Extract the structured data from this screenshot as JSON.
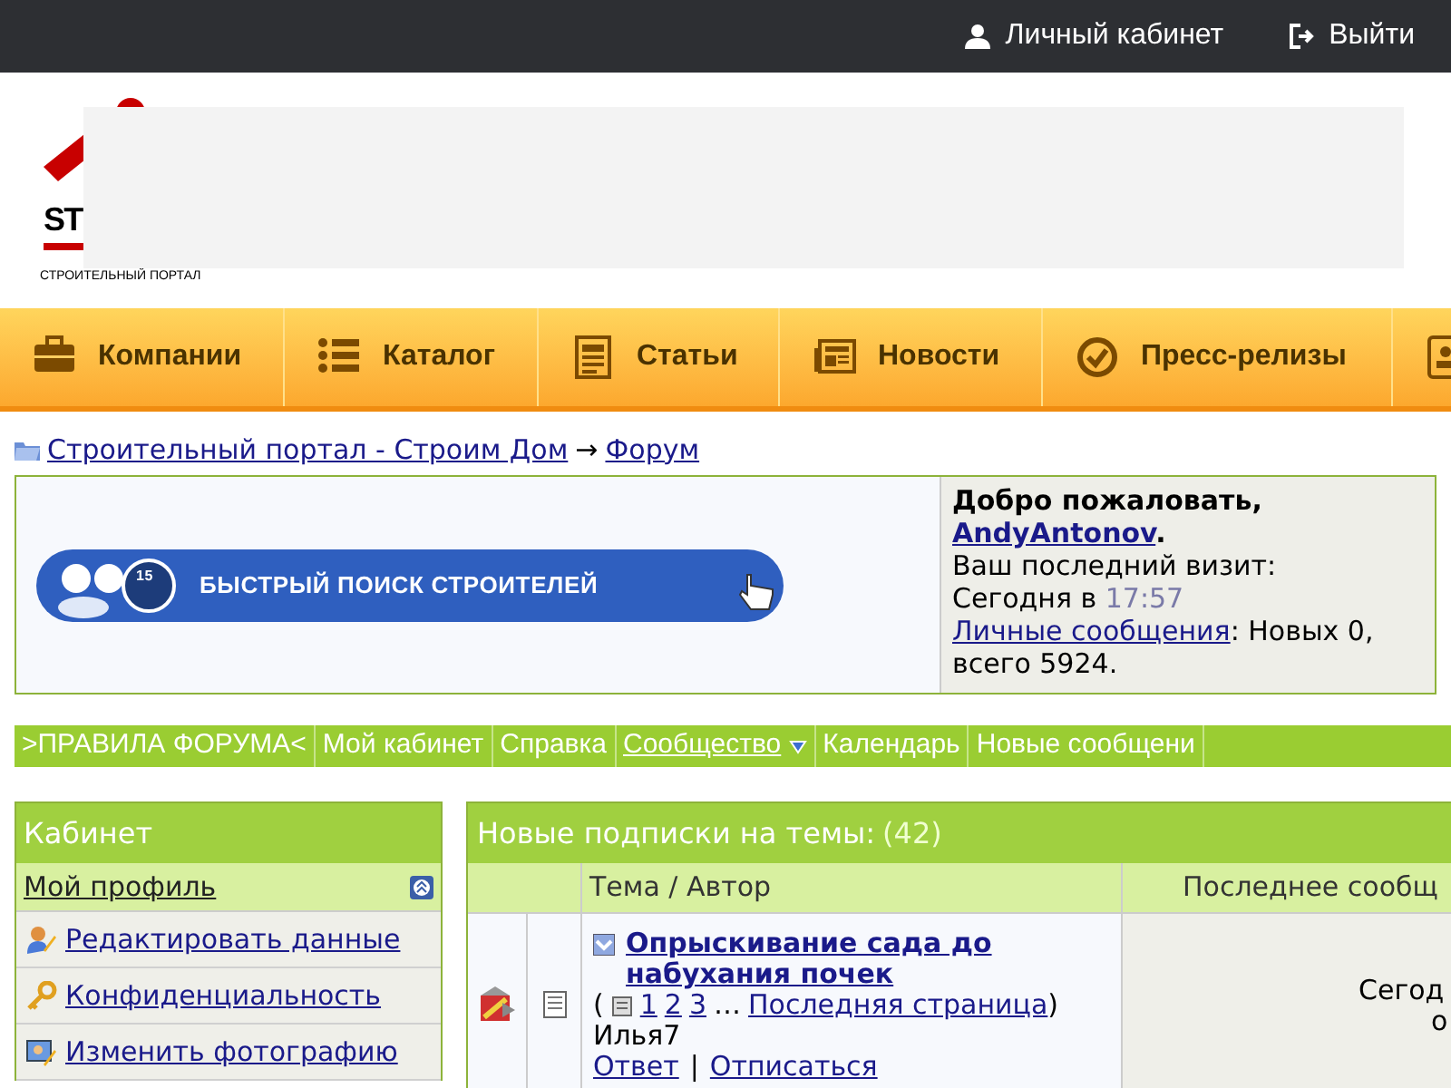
{
  "top_bar": {
    "items": [
      "Личный кабинет",
      "Выйти"
    ]
  },
  "logo": {
    "mark": "ST",
    "caption": "СТРОИТЕЛЬНЫЙ ПОРТАЛ"
  },
  "nav": [
    {
      "kind": "link",
      "label": "Компании"
    },
    {
      "kind": "link",
      "label": "Каталог"
    },
    {
      "kind": "link",
      "label": "Статьи"
    },
    {
      "kind": "link",
      "label": "Новости"
    },
    {
      "kind": "link",
      "label": "Пресс-релизы"
    },
    {
      "kind": "icon-only"
    }
  ],
  "breadcrumb": {
    "links": [
      "Строительный портал - Строим Дом",
      "Форум"
    ],
    "separator": "→"
  },
  "welcome": {
    "banner": "БЫСТРЫЙ ПОИСК СТРОИТЕЛЕЙ",
    "badge": "15",
    "greeting": "Добро пожаловать,",
    "user": "AndyAntonov",
    "user_suffix": ".",
    "last_visit_label": "Ваш последний визит:",
    "last_visit_day": "Сегодня в",
    "last_visit_time": "17:57",
    "messages_link": "Личные сообщения",
    "messages_text": ": Новых 0, всего 5924."
  },
  "forum_menu": [
    {
      "label": ">ПРАВИЛА ФОРУМА<",
      "link": false,
      "dropdown": false
    },
    {
      "label": "Мой кабинет",
      "link": false,
      "dropdown": false
    },
    {
      "label": "Справка",
      "link": false,
      "dropdown": false
    },
    {
      "label": "Сообщество",
      "link": true,
      "dropdown": true
    },
    {
      "label": "Календарь",
      "link": false,
      "dropdown": false
    },
    {
      "label": "Новые сообщени",
      "link": false,
      "dropdown": false
    }
  ],
  "cabinet": {
    "title": "Кабинет",
    "section": "Мой профиль",
    "items": [
      "Редактировать данные",
      "Конфиденциальность",
      "Изменить фотографию"
    ]
  },
  "subscriptions": {
    "title": "Новые подписки на темы:",
    "count": "(42)",
    "columns": [
      "Тема / Автор",
      "Последнее сообщ"
    ],
    "rows": [
      {
        "title": "Опрыскивание сада до набухания почек",
        "open_paren": "(",
        "pages": [
          "1",
          "2",
          "3"
        ],
        "ellipsis": "…",
        "last_page": "Последняя страница",
        "close_paren": ")",
        "author": "Илья7",
        "actions": [
          "Ответ",
          "Отписаться"
        ],
        "action_separator": "|",
        "last_post": [
          "Сегод",
          "о"
        ]
      }
    ]
  }
}
